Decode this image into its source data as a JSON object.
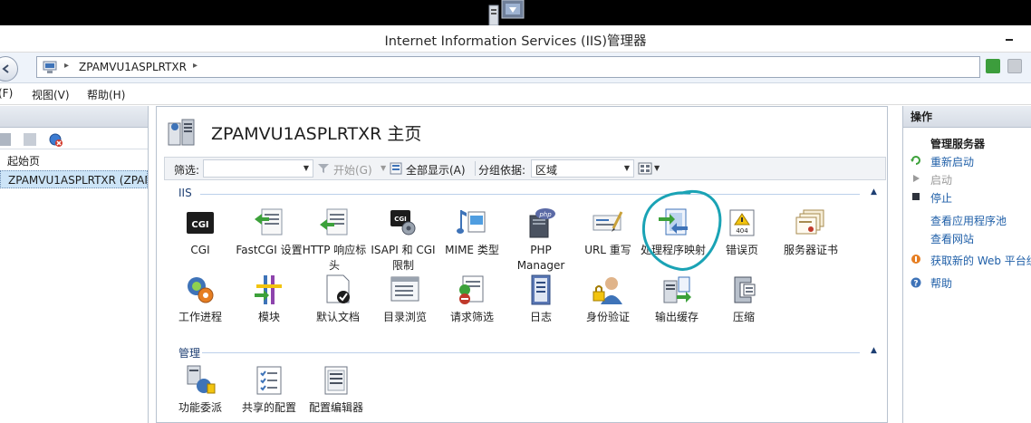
{
  "window": {
    "title": "Internet Information Services (IIS)管理器"
  },
  "address": {
    "crumb": "ZPAMVU1ASPLRTXR",
    "separator": "▸"
  },
  "menu": {
    "file": "(F)",
    "view": "视图(V)",
    "help": "帮助(H)"
  },
  "tree": {
    "items": [
      {
        "label": "起始页"
      },
      {
        "label": "ZPAMVU1ASPLRTXR (ZPAM"
      }
    ]
  },
  "main": {
    "title": "ZPAMVU1ASPLRTXR 主页",
    "filter": {
      "label": "筛选:",
      "value": "",
      "start": "开始(G)",
      "show_all": "全部显示(A)",
      "group_by_label": "分组依据:",
      "group_by_value": "区域"
    },
    "groups": [
      {
        "name": "IIS",
        "features": [
          {
            "label": "CGI",
            "icon": "cgi-icon"
          },
          {
            "label": "FastCGI 设置",
            "icon": "fastcgi-icon"
          },
          {
            "label": "HTTP 响应标头",
            "icon": "http-headers-icon"
          },
          {
            "label": "ISAPI 和 CGI 限制",
            "icon": "isapi-cgi-icon"
          },
          {
            "label": "MIME 类型",
            "icon": "mime-icon"
          },
          {
            "label": "PHP Manager",
            "icon": "php-icon"
          },
          {
            "label": "URL 重写",
            "icon": "url-rewrite-icon"
          },
          {
            "label": "处理程序映射",
            "icon": "handler-mappings-icon"
          },
          {
            "label": "错误页",
            "icon": "error-pages-icon"
          },
          {
            "label": "服务器证书",
            "icon": "certificates-icon"
          },
          {
            "label": "工作进程",
            "icon": "worker-process-icon"
          },
          {
            "label": "模块",
            "icon": "modules-icon"
          },
          {
            "label": "默认文档",
            "icon": "default-document-icon"
          },
          {
            "label": "目录浏览",
            "icon": "directory-browsing-icon"
          },
          {
            "label": "请求筛选",
            "icon": "request-filtering-icon"
          },
          {
            "label": "日志",
            "icon": "logging-icon"
          },
          {
            "label": "身份验证",
            "icon": "authentication-icon"
          },
          {
            "label": "输出缓存",
            "icon": "output-cache-icon"
          },
          {
            "label": "压缩",
            "icon": "compression-icon"
          }
        ]
      },
      {
        "name": "管理",
        "features": [
          {
            "label": "功能委派",
            "icon": "feature-delegation-icon"
          },
          {
            "label": "共享的配置",
            "icon": "shared-config-icon"
          },
          {
            "label": "配置编辑器",
            "icon": "config-editor-icon"
          }
        ]
      }
    ]
  },
  "actions": {
    "header": "操作",
    "section": "管理服务器",
    "items": [
      {
        "label": "重新启动",
        "state": "enabled"
      },
      {
        "label": "启动",
        "state": "disabled"
      },
      {
        "label": "停止",
        "state": "enabled"
      },
      {
        "label": "查看应用程序池",
        "state": "enabled"
      },
      {
        "label": "查看网站",
        "state": "enabled"
      },
      {
        "label": "获取新的 Web 平台组",
        "state": "enabled"
      },
      {
        "label": "帮助",
        "state": "enabled"
      }
    ]
  },
  "colors": {
    "link": "#1f5fa8",
    "annotation": "#1aa3b5",
    "selection": "#cce4f7"
  }
}
